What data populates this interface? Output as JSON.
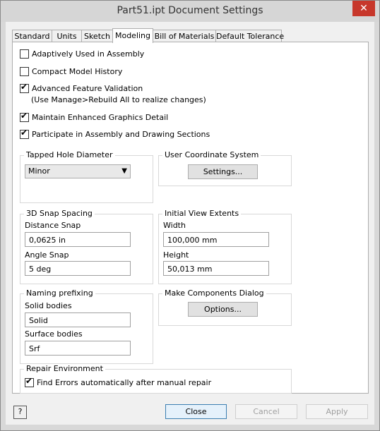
{
  "window": {
    "title": "Part51.ipt Document Settings",
    "close_glyph": "✕"
  },
  "tabs": [
    {
      "label": "Standard"
    },
    {
      "label": "Units"
    },
    {
      "label": "Sketch"
    },
    {
      "label": "Modeling"
    },
    {
      "label": "Bill of Materials"
    },
    {
      "label": "Default Tolerance"
    }
  ],
  "options": {
    "adaptively_used": {
      "label": "Adaptively Used in Assembly",
      "checked": false
    },
    "compact_history": {
      "label": "Compact Model History",
      "checked": false
    },
    "advanced_validation": {
      "label": "Advanced Feature Validation",
      "note": "(Use Manage>Rebuild All to realize changes)",
      "checked": true
    },
    "enhanced_graphics": {
      "label": "Maintain Enhanced Graphics Detail",
      "checked": true
    },
    "participate_sections": {
      "label": "Participate in Assembly and Drawing Sections",
      "checked": true
    }
  },
  "tapped_hole": {
    "title": "Tapped Hole Diameter",
    "selected": "Minor"
  },
  "ucs": {
    "title": "User Coordinate System",
    "button": "Settings..."
  },
  "snap": {
    "title": "3D Snap Spacing",
    "distance_label": "Distance Snap",
    "distance_value": "0,0625 in",
    "angle_label": "Angle Snap",
    "angle_value": "5 deg"
  },
  "view_extents": {
    "title": "Initial View Extents",
    "width_label": "Width",
    "width_value": "100,000 mm",
    "height_label": "Height",
    "height_value": "50,013 mm"
  },
  "naming": {
    "title": "Naming prefixing",
    "solid_label": "Solid bodies",
    "solid_value": "Solid",
    "surface_label": "Surface bodies",
    "surface_value": "Srf"
  },
  "make_components": {
    "title": "Make Components Dialog",
    "button": "Options..."
  },
  "repair": {
    "title": "Repair Environment",
    "checkbox_label": "Find Errors automatically after manual repair",
    "checked": true
  },
  "footer": {
    "help_glyph": "?",
    "close": "Close",
    "cancel": "Cancel",
    "apply": "Apply"
  },
  "check_glyph": "✔"
}
